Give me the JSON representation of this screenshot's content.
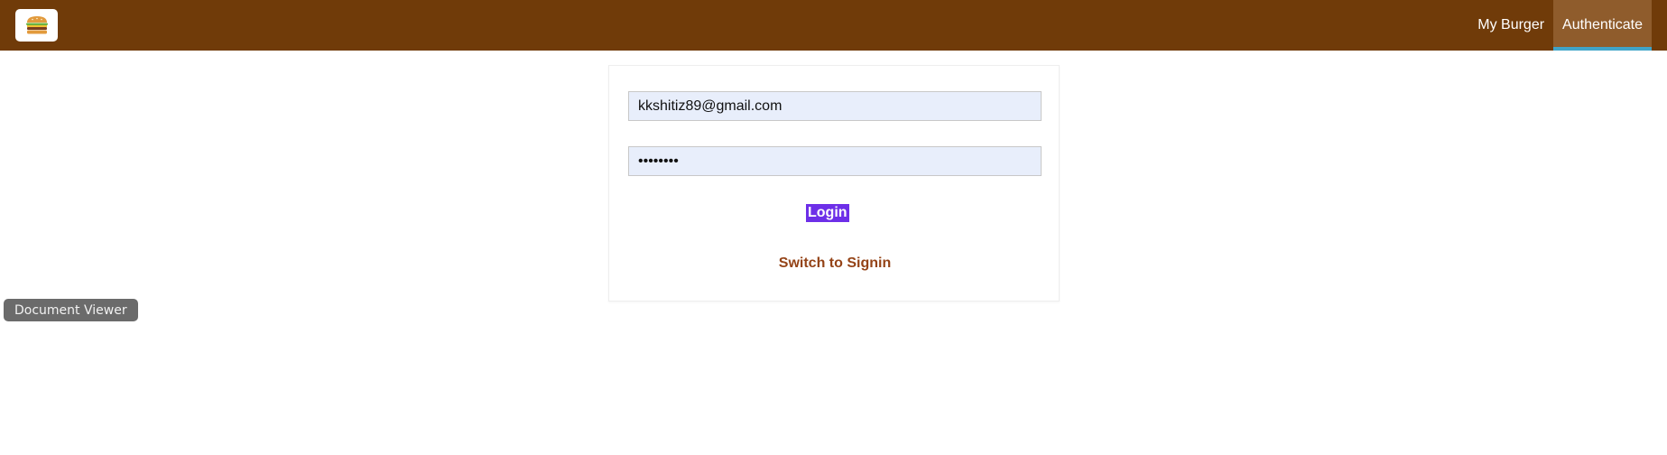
{
  "toolbar": {
    "logo_icon": "burger-icon",
    "nav": [
      {
        "label": "My Burger",
        "active": false
      },
      {
        "label": "Authenticate",
        "active": true
      }
    ],
    "colors": {
      "bar": "#703B09",
      "active_item": "#8F5C2C",
      "active_underline": "#40A4C8"
    }
  },
  "auth": {
    "email": {
      "value": "kkshitiz89@gmail.com",
      "type": "email"
    },
    "password": {
      "value": "••••••••",
      "type": "password"
    },
    "login_label": "Login",
    "switch_label": "Switch to Signin",
    "colors": {
      "input_bg": "#E8EEFB",
      "login_bg": "#6D2FE8",
      "switch_text": "#944317"
    }
  },
  "overlay": {
    "document_viewer_label": "Document Viewer"
  }
}
